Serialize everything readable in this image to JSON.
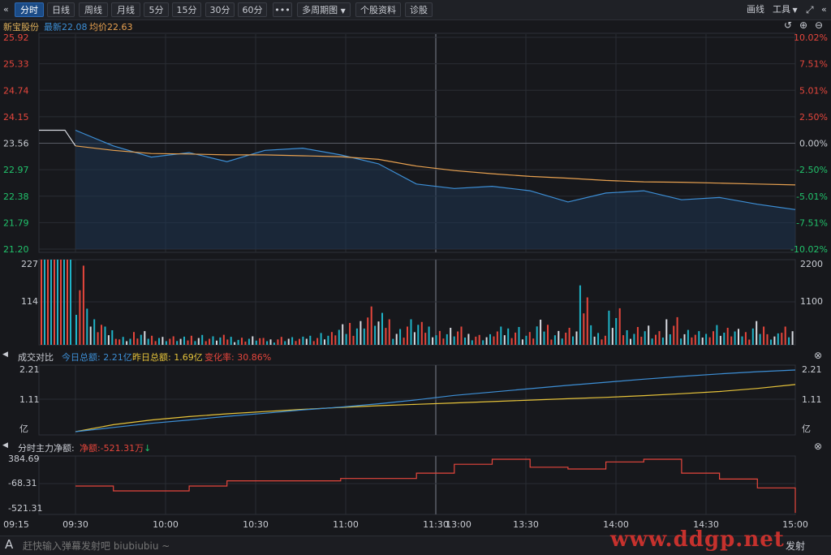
{
  "toolbar": {
    "back_icon": "«",
    "tabs": [
      "分时",
      "日线",
      "周线",
      "月线",
      "5分",
      "15分",
      "30分",
      "60分"
    ],
    "active_tab": "分时",
    "more_label": "•••",
    "period_label": "多周期图",
    "profile_label": "个股资料",
    "diagnose_label": "诊股",
    "draw_label": "画线",
    "tools_label": "工具",
    "fullscreen_icon": "expand-icon",
    "collapse_icon": "«"
  },
  "quote": {
    "name": "新宝股份",
    "latest_label": "最新22.08",
    "avg_label": "均价22.63",
    "colors": {
      "name": "#e0b15a",
      "latest": "#3d8fd6",
      "avg": "#e8a150"
    }
  },
  "price_axis": {
    "left": [
      "25.92",
      "25.33",
      "24.74",
      "24.15",
      "23.56",
      "22.97",
      "22.38",
      "21.79",
      "21.20"
    ],
    "right": [
      "10.02%",
      "7.51%",
      "5.01%",
      "2.50%",
      "0.00%",
      "-2.50%",
      "-5.01%",
      "-7.51%",
      "-10.02%"
    ]
  },
  "volume_axis": {
    "left": [
      "227",
      "114"
    ],
    "right": [
      "2200",
      "1100"
    ]
  },
  "compare_panel": {
    "title": "成交对比",
    "today": "今日总额: 2.21亿",
    "yesterday": "昨日总额: 1.69亿",
    "change": "变化率: 30.86%",
    "axis_left": [
      "2.21",
      "1.11",
      "亿"
    ],
    "axis_right": [
      "2.21",
      "1.11",
      "亿"
    ]
  },
  "flow_panel": {
    "title": "分时主力净额:",
    "net": "净额:-521.31万",
    "axis_left": [
      "384.69",
      "-68.31",
      "-521.31"
    ]
  },
  "time_axis": [
    "09:15",
    "09:30",
    "10:00",
    "10:30",
    "11:00",
    "11:30",
    "13:00",
    "13:30",
    "14:00",
    "14:30",
    "15:00"
  ],
  "danmaku": {
    "placeholder": "赶快输入弹幕发射吧 biubiubiu ~",
    "send_label": "发射"
  },
  "watermark": "www.ddgp.net",
  "chart_data": {
    "type": "line",
    "title": "新宝股份",
    "prev_close": 23.56,
    "ylim": [
      21.2,
      25.92
    ],
    "x": [
      "09:15",
      "09:30",
      "10:00",
      "10:30",
      "11:00",
      "11:30",
      "13:00",
      "13:30",
      "14:00",
      "14:30",
      "15:00"
    ],
    "series": [
      {
        "name": "最新",
        "color": "#3d8fd6",
        "values": [
          23.85,
          23.5,
          23.25,
          23.35,
          23.15,
          23.4,
          23.45,
          23.3,
          23.1,
          22.65,
          22.55,
          22.6,
          22.5,
          22.25,
          22.45,
          22.5,
          22.3,
          22.35,
          22.2,
          22.08
        ]
      },
      {
        "name": "均价",
        "color": "#e8a150",
        "values": [
          23.5,
          23.4,
          23.33,
          23.32,
          23.3,
          23.3,
          23.28,
          23.26,
          23.2,
          23.05,
          22.95,
          22.88,
          22.82,
          22.78,
          22.73,
          22.7,
          22.69,
          22.67,
          22.65,
          22.63
        ]
      }
    ],
    "volume": [
      200,
      60,
      40,
      20,
      30,
      25,
      20,
      18,
      25,
      20,
      22,
      18,
      20,
      15,
      20,
      18,
      25,
      30,
      45,
      60,
      90,
      70,
      40,
      60,
      50,
      35,
      40,
      30,
      25,
      40,
      45,
      30,
      55,
      35,
      40,
      130,
      30,
      80,
      40,
      45,
      30,
      70,
      35,
      30,
      50,
      40,
      35,
      60,
      25,
      50
    ],
    "turnover_today": [
      0.0,
      0.15,
      0.3,
      0.42,
      0.55,
      0.66,
      0.78,
      0.88,
      1.0,
      1.14,
      1.3,
      1.42,
      1.54,
      1.66,
      1.77,
      1.88,
      1.98,
      2.07,
      2.15,
      2.21
    ],
    "turnover_yesterday": [
      0.0,
      0.25,
      0.42,
      0.54,
      0.64,
      0.72,
      0.8,
      0.87,
      0.93,
      0.98,
      1.03,
      1.08,
      1.13,
      1.18,
      1.23,
      1.29,
      1.36,
      1.44,
      1.55,
      1.69
    ],
    "net_flow": [
      -68.31,
      -150,
      -150,
      -68.31,
      20,
      20,
      20,
      60,
      60,
      150,
      300,
      384.69,
      250,
      220,
      340,
      384.69,
      150,
      50,
      -100,
      -521.31
    ]
  }
}
